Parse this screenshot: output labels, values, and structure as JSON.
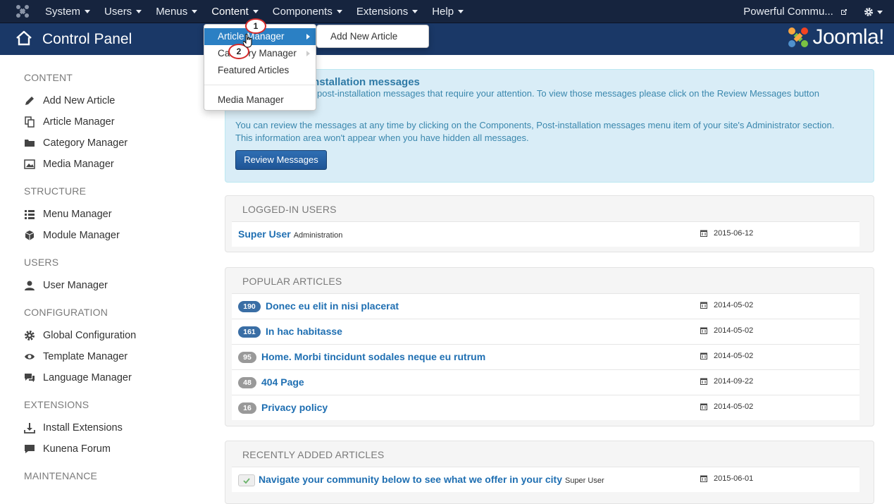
{
  "topnav": {
    "items": [
      {
        "label": "System",
        "caret": true
      },
      {
        "label": "Users",
        "caret": true
      },
      {
        "label": "Menus",
        "caret": true
      },
      {
        "label": "Content",
        "caret": true
      },
      {
        "label": "Components",
        "caret": true
      },
      {
        "label": "Extensions",
        "caret": true
      },
      {
        "label": "Help",
        "caret": true
      }
    ],
    "site_link": "Powerful Commu...",
    "settings_icon": "gear-icon"
  },
  "header": {
    "title": "Control Panel",
    "brand": "Joomla!",
    "colors": {
      "topbar": "#16243e",
      "header": "#1a3867",
      "accent": "#2b80c4"
    }
  },
  "sidebar": {
    "sections": [
      {
        "heading": "CONTENT",
        "items": [
          {
            "label": "Add New Article",
            "icon": "pencil-icon"
          },
          {
            "label": "Article Manager",
            "icon": "copy-icon"
          },
          {
            "label": "Category Manager",
            "icon": "folder-icon"
          },
          {
            "label": "Media Manager",
            "icon": "image-icon"
          }
        ]
      },
      {
        "heading": "STRUCTURE",
        "items": [
          {
            "label": "Menu Manager",
            "icon": "list-icon"
          },
          {
            "label": "Module Manager",
            "icon": "cube-icon"
          }
        ]
      },
      {
        "heading": "USERS",
        "items": [
          {
            "label": "User Manager",
            "icon": "user-icon"
          }
        ]
      },
      {
        "heading": "CONFIGURATION",
        "items": [
          {
            "label": "Global Configuration",
            "icon": "cog-icon"
          },
          {
            "label": "Template Manager",
            "icon": "eye-icon"
          },
          {
            "label": "Language Manager",
            "icon": "comments-icon"
          }
        ]
      },
      {
        "heading": "EXTENSIONS",
        "items": [
          {
            "label": "Install Extensions",
            "icon": "download-icon"
          },
          {
            "label": "Kunena Forum",
            "icon": "comment-icon"
          }
        ]
      },
      {
        "heading": "MAINTENANCE",
        "items": []
      }
    ]
  },
  "postinstall": {
    "title": "installation messages",
    "line1": "post-installation messages that require your attention. To view those messages please click on the Review Messages button",
    "line2": "You can review the messages at any time by clicking on the Components, Post-installation messages menu item of your site's Administrator section.",
    "line3": "This information area won't appear when you have hidden all messages.",
    "button": "Review Messages"
  },
  "logged_in": {
    "title": "LOGGED-IN USERS",
    "rows": [
      {
        "name": "Super User",
        "meta": "Administration",
        "date": "2015-06-12"
      }
    ]
  },
  "popular": {
    "title": "POPULAR ARTICLES",
    "rows": [
      {
        "hits": "190",
        "title": "Donec eu elit in nisi placerat",
        "date": "2014-05-02"
      },
      {
        "hits": "161",
        "title": "In hac habitasse",
        "date": "2014-05-02"
      },
      {
        "hits": "95",
        "title": "Home. Morbi tincidunt sodales neque eu rutrum",
        "date": "2014-05-02"
      },
      {
        "hits": "48",
        "title": "404 Page",
        "date": "2014-09-22"
      },
      {
        "hits": "16",
        "title": "Privacy policy",
        "date": "2014-05-02"
      }
    ]
  },
  "recent": {
    "title": "RECENTLY ADDED ARTICLES",
    "rows": [
      {
        "title": "Navigate your community below to see what we offer in your city",
        "author": "Super User",
        "date": "2015-06-01"
      }
    ]
  },
  "content_menu": {
    "items": [
      "Article Manager",
      "Category Manager",
      "Featured Articles",
      "Media Manager"
    ],
    "submenu": [
      "Add New Article"
    ]
  },
  "markers": [
    "1",
    "2"
  ]
}
